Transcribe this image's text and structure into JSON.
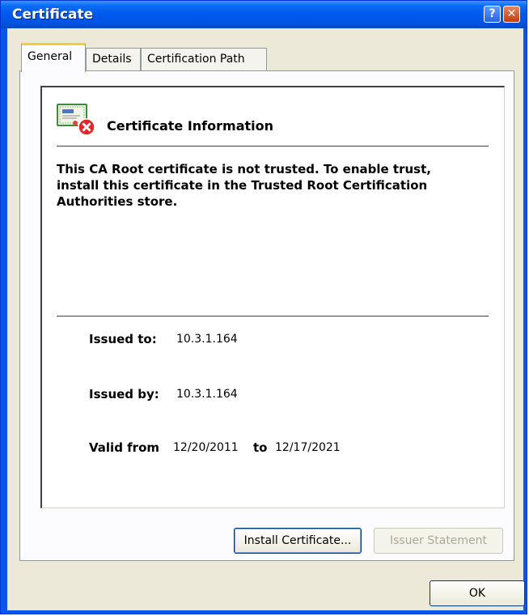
{
  "window": {
    "title": "Certificate",
    "help_glyph": "?",
    "close_glyph": "✕"
  },
  "tabs": [
    {
      "label": "General",
      "active": true
    },
    {
      "label": "Details",
      "active": false
    },
    {
      "label": "Certification Path",
      "active": false
    }
  ],
  "general": {
    "heading": "Certificate Information",
    "icon": "certificate-error-icon",
    "warning": "This CA Root certificate is not trusted. To enable trust, install this certificate in the Trusted Root Certification Authorities store.",
    "issued_to_label": "Issued to:",
    "issued_to": "10.3.1.164",
    "issued_by_label": "Issued by:",
    "issued_by": "10.3.1.164",
    "valid_from_label": "Valid from",
    "valid_from": "12/20/2011",
    "valid_to_label": "to",
    "valid_to": "12/17/2021"
  },
  "buttons": {
    "install": "Install Certificate...",
    "issuer_statement": "Issuer Statement",
    "ok": "OK"
  },
  "colors": {
    "titlebar": "#0054e3",
    "dialog_bg": "#ece9d8",
    "error_red": "#e0282b",
    "active_tab_accent": "#ffc83c"
  }
}
